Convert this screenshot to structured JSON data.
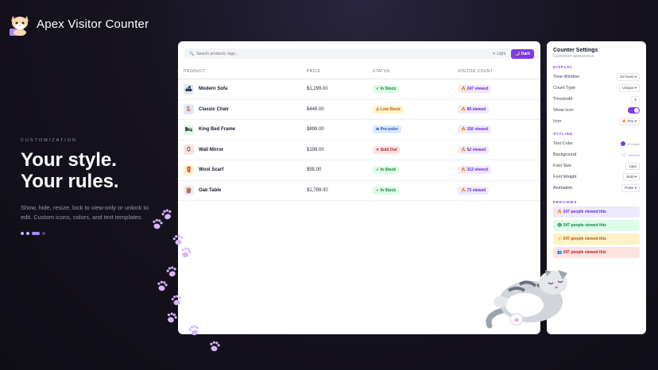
{
  "app": {
    "title": "Apex Visitor Counter"
  },
  "hero": {
    "eyebrow": "CUSTOMIZATION",
    "title_line1": "Your style.",
    "title_line2": "Your rules.",
    "description": "Show, hide, resize, lock to view-only or unlock to edit. Custom icons, colors, and text templates."
  },
  "toolbar": {
    "search_placeholder": "Search products, tags...",
    "light_label": "☀ Light",
    "dark_label": "🌙 Dark",
    "active_theme": "dark"
  },
  "table": {
    "columns": [
      "PRODUCT",
      "PRICE",
      "STATUS",
      "VISITOR COUNT"
    ],
    "rows": [
      {
        "icon": "sofa-icon",
        "glyph": "🛋",
        "thumb_bg": "#dbeafe",
        "name": "Modern Sofa",
        "price": "$1,299.00",
        "status": "✓ In Stock",
        "status_type": "green",
        "views": "🔥 247 viewed"
      },
      {
        "icon": "chair-icon",
        "glyph": "🪑",
        "thumb_bg": "#e0e7ff",
        "name": "Classic Chair",
        "price": "$449.00",
        "status": "⚠ Low Stock",
        "status_type": "amber",
        "views": "🔥 89 viewed"
      },
      {
        "icon": "bed-icon",
        "glyph": "🛏",
        "thumb_bg": "#dcfce7",
        "name": "King Bed Frame",
        "price": "$899.00",
        "status": "⊕ Pre-order",
        "status_type": "blue",
        "views": "🔥 156 viewed"
      },
      {
        "icon": "mirror-icon",
        "glyph": "⬯",
        "thumb_bg": "#fee2e2",
        "name": "Wall Mirror",
        "price": "$199.00",
        "status": "✕ Sold Out",
        "status_type": "red",
        "views": "🔥 52 viewed"
      },
      {
        "icon": "scarf-icon",
        "glyph": "🧣",
        "thumb_bg": "#fef3c7",
        "name": "Wool Scarf",
        "price": "$55.00",
        "status": "✓ In Stock",
        "status_type": "green",
        "views": "🔥 312 viewed"
      },
      {
        "icon": "table-icon",
        "glyph": "🪵",
        "thumb_bg": "#ede9fe",
        "name": "Oak Table",
        "price": "$1,799.00",
        "status": "✓ In Stock",
        "status_type": "green",
        "views": "🔥 73 viewed"
      }
    ]
  },
  "settings": {
    "title": "Counter Settings",
    "subtitle": "Customize appearance",
    "display_heading": "DISPLAY",
    "display": [
      {
        "label": "Time Window",
        "value": "24 hours ▾"
      },
      {
        "label": "Count Type",
        "value": "Unique ▾"
      },
      {
        "label": "Threshold",
        "value": "5"
      },
      {
        "label": "Show Icon",
        "value": ""
      },
      {
        "label": "Icon",
        "value": "🔥 Fire ▾"
      }
    ],
    "styling_heading": "STYLING",
    "styling": [
      {
        "label": "Text Color",
        "value": "#7c3aed",
        "swatch": "#7c3aed"
      },
      {
        "label": "Background",
        "value": "#ede9fe",
        "swatch": "#ede9fe"
      },
      {
        "label": "Font Size",
        "value": "13px"
      },
      {
        "label": "Font Weight",
        "value": "Bold ▾"
      },
      {
        "label": "Animation",
        "value": "Pulse ▾"
      }
    ],
    "previews_heading": "PREVIEWS",
    "previews": [
      {
        "text": "🔥 247 people viewed this",
        "bg": "#ede9fe",
        "fg": "#6d28d9"
      },
      {
        "text": "👁 247 people viewed this",
        "bg": "#dcfce7",
        "fg": "#15803d"
      },
      {
        "text": "⚡ 247 people viewed this",
        "bg": "#fef3c7",
        "fg": "#b45309"
      },
      {
        "text": "👥 247 people viewed this",
        "bg": "#fee2e2",
        "fg": "#b91c1c"
      }
    ]
  },
  "colors": {
    "accent": "#7c3aed",
    "paw": "#d8b4fe"
  }
}
